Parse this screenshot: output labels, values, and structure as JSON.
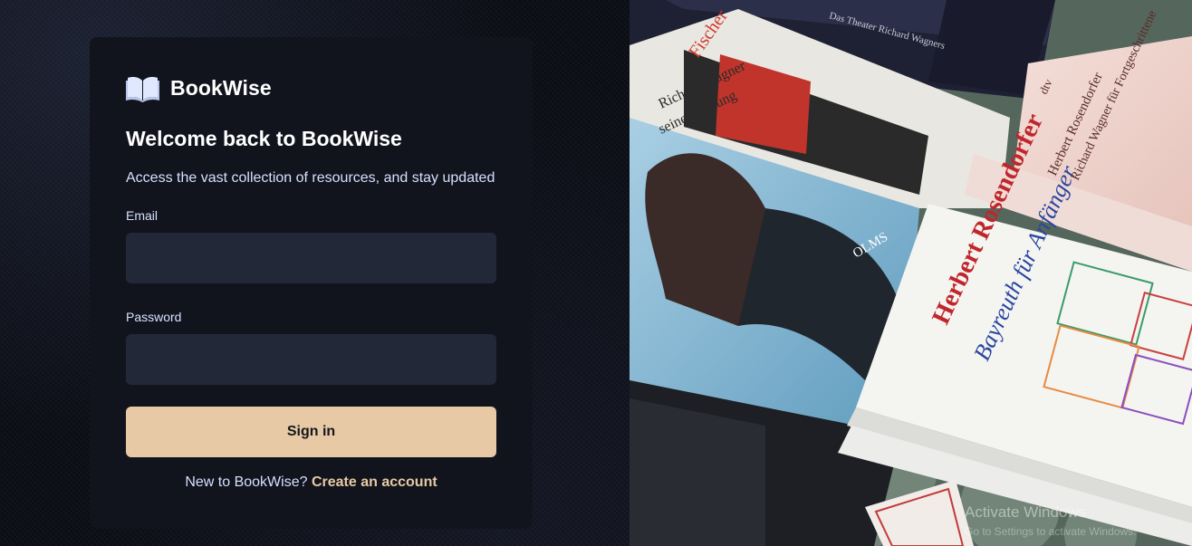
{
  "brand": {
    "name": "BookWise",
    "logo_icon": "open-book-icon"
  },
  "login": {
    "title": "Welcome back to BookWise",
    "subtitle": "Access the vast collection of resources, and stay updated",
    "email_label": "Email",
    "email_value": "",
    "password_label": "Password",
    "password_value": "",
    "submit_label": "Sign in",
    "signup_prompt": "New to BookWise?",
    "signup_link": "Create an account"
  },
  "hero": {
    "book_spine_1": "Richard Wagner",
    "book_spine_2": "Das Theater Richard Wagners",
    "book_title_fischer": "Fischer",
    "book_subtitle_wirkung": "seine Wirkung",
    "book_publisher_olms": "OLMS",
    "book_author": "Herbert Rosendorfer",
    "book_title": "Bayreuth für Anfänger",
    "book_pink_author": "Herbert Rosendorfer",
    "book_pink_title": "Richard Wagner für Fortgeschrittene",
    "book_pink_publisher": "dtv"
  },
  "system": {
    "activate_title": "Activate Windows",
    "activate_sub": "Go to Settings to activate Windows."
  },
  "colors": {
    "accent": "#e7c9a5",
    "card_bg": "#12141d",
    "input_bg": "#232839",
    "page_bg": "#0a0c14",
    "text_light": "#d6e0ff"
  }
}
